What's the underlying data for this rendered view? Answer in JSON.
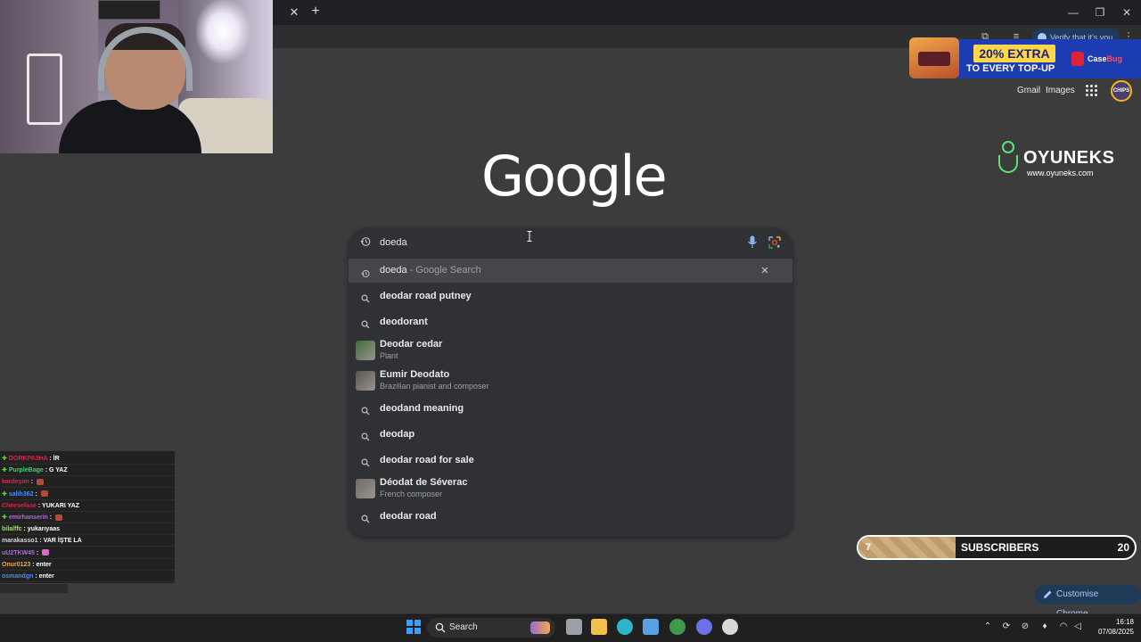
{
  "browser": {
    "verify_label": "Verify that it's you"
  },
  "google": {
    "logo": "Google",
    "top_links": {
      "gmail": "Gmail",
      "images": "Images"
    },
    "avatar_text": "CHIPS"
  },
  "search": {
    "query": "doeda",
    "suggestions": [
      {
        "type": "history",
        "bold": "doeda",
        "rest": " - Google Search",
        "removable": true
      },
      {
        "type": "query",
        "text": "deodar road putney"
      },
      {
        "type": "query",
        "text": "deodorant"
      },
      {
        "type": "entity",
        "title": "Deodar cedar",
        "subtitle": "Plant",
        "thumb_color": "#3f6b3a"
      },
      {
        "type": "entity",
        "title": "Eumir Deodato",
        "subtitle": "Brazilian pianist and composer",
        "thumb_color": "#5a5450"
      },
      {
        "type": "query",
        "text": "deodand meaning"
      },
      {
        "type": "query",
        "text": "deodap"
      },
      {
        "type": "query",
        "text": "deodar road for sale"
      },
      {
        "type": "entity",
        "title": "Déodat de Séverac",
        "subtitle": "French composer",
        "thumb_color": "#6e6a64"
      },
      {
        "type": "query",
        "text": "deodar road"
      }
    ]
  },
  "promo": {
    "headline": "20% EXTRA",
    "subline": "TO EVERY TOP-UP",
    "brand_a": "Case",
    "brand_b": "Bug"
  },
  "oyuneks": {
    "name": "OYUNEKS",
    "url": "www.oyuneks.com"
  },
  "chat": [
    {
      "nick": "DORKPA3HA",
      "nick_color": "#e0224a",
      "msg": "İR",
      "plus": true
    },
    {
      "nick": "PurpleBage",
      "nick_color": "#3fd06a",
      "msg": "G YAZ",
      "plus": true
    },
    {
      "nick": "kardeşim",
      "nick_color": "#e0224a",
      "msg": "",
      "emote": "red"
    },
    {
      "nick": "salih362",
      "nick_color": "#4a8cf0",
      "msg": "",
      "emote": "red",
      "plus": true
    },
    {
      "nick": "Cheesefase",
      "nick_color": "#e0224a",
      "msg": "YUKARI YAZ"
    },
    {
      "nick": "emirhanserin",
      "nick_color": "#b06ad7",
      "msg": "",
      "emote": "red",
      "plus": true
    },
    {
      "nick": "bilalffc",
      "nick_color": "#9ae84a",
      "msg": "yukarıyaas"
    },
    {
      "nick": "marakasso1",
      "nick_color": "#d6d6d6",
      "msg": "VAR İŞTE LA"
    },
    {
      "nick": "uU2TKW45",
      "nick_color": "#b06ad7",
      "msg": "",
      "emote": "pink"
    },
    {
      "nick": "Onur0123",
      "nick_color": "#f2a64b",
      "msg": "enter"
    },
    {
      "nick": "osmandgn",
      "nick_color": "#4a8cf0",
      "msg": "enter"
    }
  ],
  "subs": {
    "current": "7",
    "label": "SUBSCRIBERS",
    "goal": "20",
    "progress": 0.35
  },
  "customise_label": "Customise Chrome",
  "taskbar": {
    "search_label": "Search",
    "time": "16:18",
    "date": "07/08/2025",
    "apps": [
      {
        "name": "task-view",
        "color": "#9aa0a6"
      },
      {
        "name": "file-explorer",
        "color": "#f2c14b"
      },
      {
        "name": "edge",
        "color": "#2fb3c9"
      },
      {
        "name": "store",
        "color": "#5aa0e6"
      },
      {
        "name": "chrome",
        "color": "#3f9b4a"
      },
      {
        "name": "discord",
        "color": "#6a72e6"
      },
      {
        "name": "obs",
        "color": "#d8d8d8"
      }
    ]
  }
}
